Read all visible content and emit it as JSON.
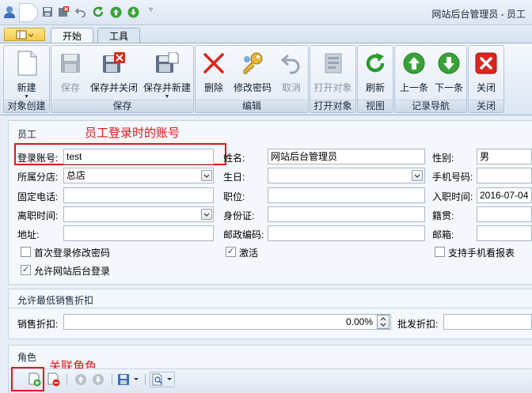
{
  "window": {
    "title": "网站后台管理员 - 员工"
  },
  "tabs": [
    {
      "label": "开始"
    },
    {
      "label": "工具"
    }
  ],
  "ribbon": {
    "groups": [
      {
        "label": "对象创建"
      },
      {
        "label": "保存"
      },
      {
        "label": "编辑"
      },
      {
        "label": "打开对象"
      },
      {
        "label": "视图"
      },
      {
        "label": "记录导航"
      },
      {
        "label": "关闭"
      }
    ],
    "buttons": [
      {
        "label": "新建",
        "icon": "new-document-icon"
      },
      {
        "label": "保存",
        "icon": "floppy-icon",
        "disabled": true
      },
      {
        "label": "保存并关闭",
        "icon": "save-close-icon"
      },
      {
        "label": "保存并新建",
        "icon": "save-new-icon"
      },
      {
        "label": "删除",
        "icon": "delete-x-icon"
      },
      {
        "label": "修改密码",
        "icon": "key-icon"
      },
      {
        "label": "取消",
        "icon": "undo-icon",
        "disabled": true
      },
      {
        "label": "打开对象",
        "icon": "open-object-icon",
        "disabled": true
      },
      {
        "label": "刷新",
        "icon": "refresh-icon"
      },
      {
        "label": "上一条",
        "icon": "arrow-up-icon"
      },
      {
        "label": "下一条",
        "icon": "arrow-down-icon"
      },
      {
        "label": "关闭",
        "icon": "close-red-icon"
      }
    ]
  },
  "employee": {
    "section_title": "员工",
    "annotation": "员工登录时的账号",
    "login_label": "登录账号:",
    "login_value": "test",
    "name_label": "姓名:",
    "name_value": "网站后台管理员",
    "gender_label": "性别:",
    "gender_value": "男",
    "branch_label": "所属分店:",
    "branch_value": "总店",
    "birthday_label": "生日:",
    "mobile_label": "手机号码:",
    "phone_label": "固定电话:",
    "position_label": "职位:",
    "hire_label": "入职时间:",
    "hire_value": "2016-07-04",
    "leave_label": "离职时间:",
    "idcard_label": "身份证:",
    "native_label": "籍贯:",
    "address_label": "地址:",
    "zip_label": "邮政编码:",
    "email_label": "邮箱:",
    "chk_first_login": "首次登录修改密码",
    "chk_active": "激活",
    "chk_mobile_report": "支持手机看报表",
    "chk_allow_backend": "允许网站后台登录"
  },
  "discount": {
    "section_title": "允许最低销售折扣",
    "sale_label": "销售折扣:",
    "sale_value": "0.00%",
    "wholesale_label": "批发折扣:"
  },
  "roles": {
    "section_title": "角色",
    "annotation": "关联角色"
  }
}
